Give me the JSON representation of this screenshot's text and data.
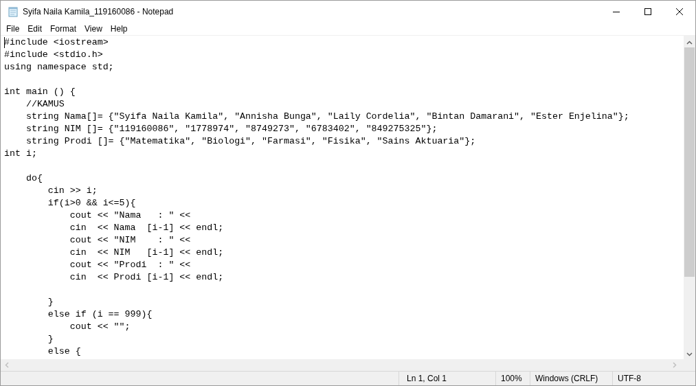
{
  "window": {
    "title": "Syifa Naila Kamila_119160086 - Notepad"
  },
  "menu": [
    "File",
    "Edit",
    "Format",
    "View",
    "Help"
  ],
  "editor": {
    "lines": [
      {
        "kind": "code",
        "text": "#include <iostream>"
      },
      {
        "kind": "code",
        "text": "#include <stdio.h>"
      },
      {
        "kind": "code",
        "text": "using namespace std;"
      },
      {
        "kind": "blank"
      },
      {
        "kind": "code",
        "text": "int main () {"
      },
      {
        "kind": "code",
        "text": "    //KAMUS"
      },
      {
        "kind": "code",
        "text": "    string Nama[]= {\"Syifa Naila Kamila\", \"Annisha Bunga\", \"Laily Cordelia\", \"Bintan Damarani\", \"Ester Enjelina\"};"
      },
      {
        "kind": "code",
        "text": "    string NIM []= {\"119160086\", \"1778974\", \"8749273\", \"6783402\", \"849275325\"};"
      },
      {
        "kind": "code",
        "text": "    string Prodi []= {\"Matematika\", \"Biologi\", \"Farmasi\", \"Fisika\", \"Sains Aktuaria\"};"
      },
      {
        "kind": "code",
        "text": "int i;"
      },
      {
        "kind": "blank"
      },
      {
        "kind": "code",
        "text": "    do{"
      },
      {
        "kind": "code",
        "text": "        cin >> i;"
      },
      {
        "kind": "code",
        "text": "        if(i>0 && i<=5){"
      },
      {
        "kind": "code",
        "text": "            cout << \"Nama   : \" <<"
      },
      {
        "kind": "code",
        "text": "            cin  << Nama  [i-1] << endl;"
      },
      {
        "kind": "code",
        "text": "            cout << \"NIM    : \" <<"
      },
      {
        "kind": "code",
        "text": "            cin  << NIM   [i-1] << endl;"
      },
      {
        "kind": "code",
        "text": "            cout << \"Prodi  : \" <<"
      },
      {
        "kind": "code",
        "text": "            cin  << Prodi [i-1] << endl;"
      },
      {
        "kind": "blank"
      },
      {
        "kind": "code",
        "text": "        }"
      },
      {
        "kind": "code",
        "text": "        else if (i == 999){"
      },
      {
        "kind": "code",
        "text": "            cout << \"\";"
      },
      {
        "kind": "code",
        "text": "        }"
      },
      {
        "kind": "code",
        "text": "        else {"
      }
    ]
  },
  "status_bar": {
    "position": "Ln 1, Col 1",
    "zoom": "100%",
    "line_ending": "Windows (CRLF)",
    "encoding": "UTF-8"
  }
}
